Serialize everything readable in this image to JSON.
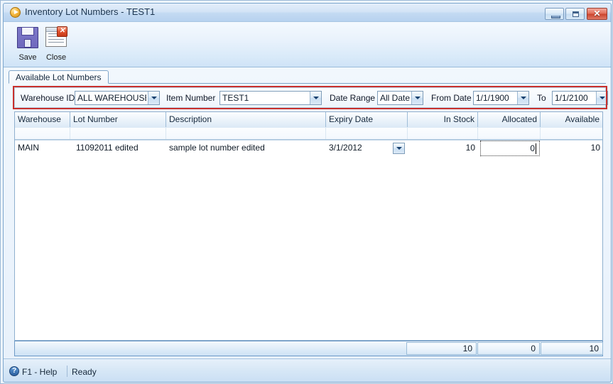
{
  "window": {
    "title": "Inventory Lot Numbers - TEST1",
    "icon": "play-circle-icon",
    "controls": {
      "minimize": "minimize-icon",
      "maximize": "maximize-icon",
      "close": "✕"
    }
  },
  "toolbar": {
    "buttons": [
      {
        "label": "Save",
        "icon": "floppy-disk-icon"
      },
      {
        "label": "Close",
        "icon": "window-close-icon"
      }
    ]
  },
  "tabs": [
    {
      "label": "Available Lot Numbers",
      "active": true
    }
  ],
  "filters": {
    "warehouse_label": "Warehouse ID",
    "warehouse_value": "ALL WAREHOUSE",
    "item_label": "Item Number",
    "item_value": "TEST1",
    "date_range_label": "Date Range",
    "date_range_value": "All Dates",
    "from_date_label": "From Date",
    "from_date_value": "1/1/1900",
    "to_label": "To",
    "to_value": "1/1/2100",
    "annotation_color": "#c9302c"
  },
  "grid": {
    "columns": [
      "Warehouse",
      "Lot Number",
      "Description",
      "Expiry Date",
      "In Stock",
      "Allocated",
      "Available"
    ],
    "rows": [
      {
        "warehouse": "MAIN",
        "lot_number": "11092011 edited",
        "description": "sample lot number edited",
        "expiry_date": "3/1/2012",
        "in_stock": "10",
        "allocated": "0",
        "available": "10"
      }
    ],
    "totals": {
      "in_stock": "10",
      "allocated": "0",
      "available": "10"
    }
  },
  "statusbar": {
    "help_icon": "?",
    "help_label": "F1 - Help",
    "status": "Ready"
  }
}
